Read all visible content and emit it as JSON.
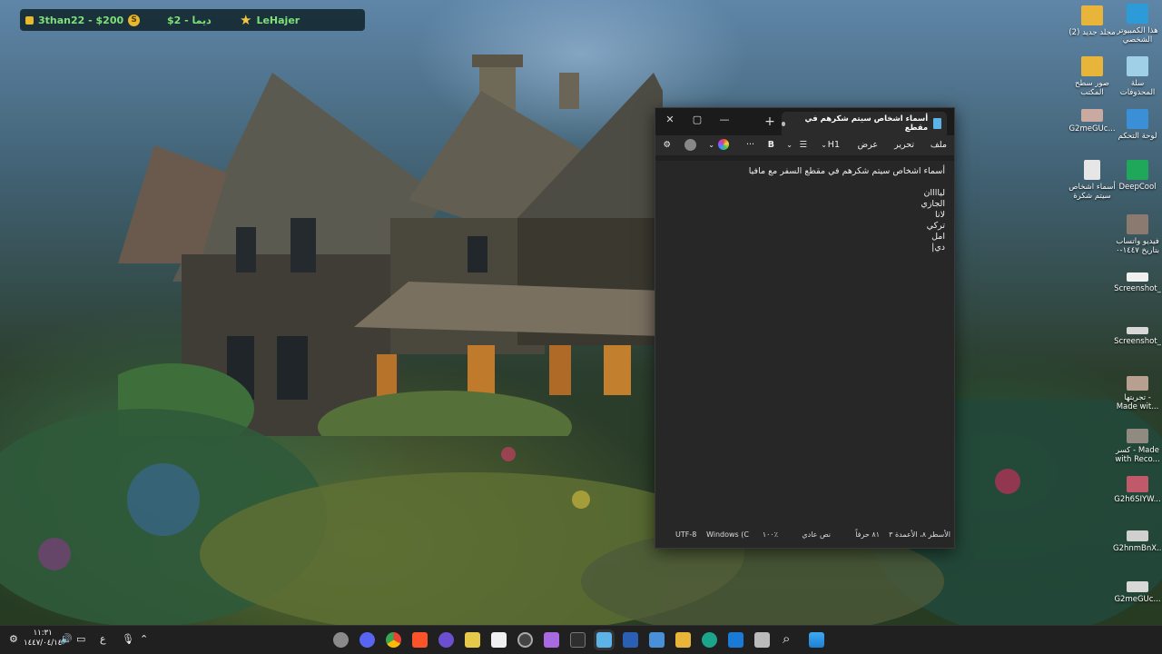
{
  "hud": {
    "player": "3than22 - $200",
    "currency": "دیما - 2$",
    "user": "LeHajer",
    "coin_symbol": "S"
  },
  "desktop_icons": [
    {
      "name": "this-pc",
      "label": "هذا الكمبيوتر الشخصي",
      "color": "#2d9bd8"
    },
    {
      "name": "new-folder-2",
      "label": "(2) مجلد جديد",
      "color": "#e8b53a"
    },
    {
      "name": "recycle-bin",
      "label": "سلة المحذوفات",
      "color": "#9fd0e8"
    },
    {
      "name": "desktop-pictures",
      "label": "صور سطح المكتب",
      "color": "#e8b53a"
    },
    {
      "name": "control-panel",
      "label": "لوحة التحكم",
      "color": "#3a8fd6"
    },
    {
      "name": "g2megu-1",
      "label": "G2meGUc...",
      "color": "#c9a9a0"
    },
    {
      "name": "deepcool",
      "label": "DeepCool",
      "color": "#1fa85a"
    },
    {
      "name": "names-doc",
      "label": "أسماء اشخاص سيتم شكرة",
      "color": "#e6e6e6"
    },
    {
      "name": "video-whatsapp",
      "label": "فيديو واتساب بتاريخ ١٤٤٧-٠",
      "color": "#8a7a70"
    },
    {
      "name": "screenshot-1",
      "label": "Screenshot_",
      "color": "#f0f0f0"
    },
    {
      "name": "screenshot-2",
      "label": "Screenshot_",
      "color": "#d8d8d8"
    },
    {
      "name": "tajribetha",
      "label": "تجربتها - Made wit...",
      "color": "#b8a090"
    },
    {
      "name": "kasr-made",
      "label": "كسر - Made with Reco...",
      "color": "#908a80"
    },
    {
      "name": "g2h6siyw",
      "label": "G2h6SIYW...",
      "color": "#c05a6a"
    },
    {
      "name": "g2hnmbnx",
      "label": "G2hnmBnX...",
      "color": "#d0d0d0"
    },
    {
      "name": "g2megu-2",
      "label": "G2meGUc...",
      "color": "#d8d8d8"
    }
  ],
  "notepad": {
    "tab_title": "أسماء اشخاص سيتم شكرهم في مقطع",
    "new_tab": "+",
    "window_controls": {
      "minimize": "—",
      "maximize": "▢",
      "close": "✕"
    },
    "menu": {
      "file": "ملف",
      "edit": "تحرير",
      "view": "عرض",
      "heading": "H1",
      "bold": "B",
      "more": "···"
    },
    "content_lines": [
      "أسماء اشخاص سيتم شكرهم في مقطع السفر مع مافيا",
      "",
      "لياااان",
      "الجازي",
      "لانا",
      "تركي",
      "امل",
      "دي|"
    ],
    "status": {
      "position": "الأسطر ٨، الأعمدة ٣",
      "chars": "٨١ حرفاً",
      "format": "نص عادي",
      "zoom": "١٠٠٪",
      "line_ending": "Windows (C",
      "encoding": "UTF-8"
    }
  },
  "taskbar": {
    "apps": [
      {
        "name": "settings",
        "color": "#8a8a8a"
      },
      {
        "name": "discord",
        "color": "#5865f2"
      },
      {
        "name": "chrome",
        "color": "#3aa757"
      },
      {
        "name": "brave",
        "color": "#fb542b"
      },
      {
        "name": "game",
        "color": "#6b4fd0"
      },
      {
        "name": "notes",
        "color": "#e6c84a"
      },
      {
        "name": "store",
        "color": "#f0f0f0"
      },
      {
        "name": "obs",
        "color": "#444444"
      },
      {
        "name": "pen",
        "color": "#a86ae0"
      },
      {
        "name": "xbox",
        "color": "#2f2f2f"
      },
      {
        "name": "notepad",
        "color": "#5bb3e8"
      },
      {
        "name": "word",
        "color": "#2b5fb4"
      },
      {
        "name": "calculator",
        "color": "#4a90d9"
      },
      {
        "name": "explorer",
        "color": "#e8b53a"
      },
      {
        "name": "edge",
        "color": "#1ba58a"
      },
      {
        "name": "outlook",
        "color": "#1a7bd6"
      },
      {
        "name": "task-view",
        "color": "#bbbbbb"
      },
      {
        "name": "search",
        "color": "#202020"
      },
      {
        "name": "start",
        "color": "#3fa9f5"
      }
    ],
    "time": "١١:٣١",
    "date": "١٤٤٧/٠٤/١٤",
    "lang": "ع"
  }
}
